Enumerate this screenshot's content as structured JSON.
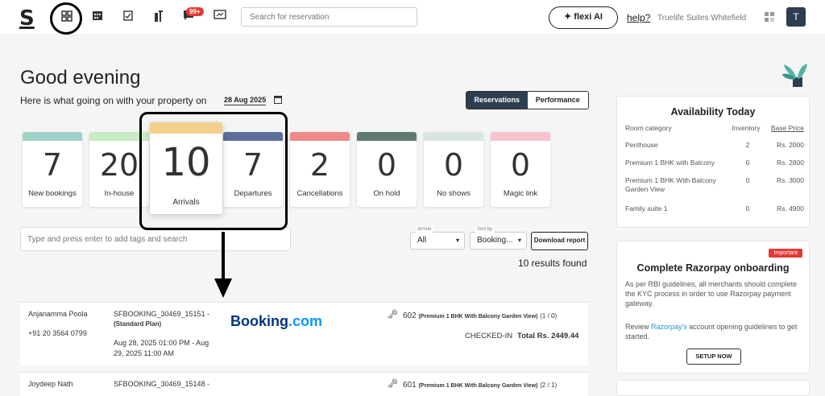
{
  "topbar": {
    "logo": "S",
    "badge": "99+",
    "search_placeholder": "Search for reservation",
    "flexi_label": "flexi AI",
    "help_label": "help?",
    "property_name": "Truelife Suites Whitefield",
    "avatar_initial": "T"
  },
  "header": {
    "greeting": "Good evening",
    "subline": "Here is what going on with your property on",
    "date": "28 Aug 2025",
    "tabs": [
      {
        "label": "Reservations",
        "active": true
      },
      {
        "label": "Performance",
        "active": false
      }
    ]
  },
  "stats": [
    {
      "value": "7",
      "label": "New bookings",
      "color": "#9fd3c7"
    },
    {
      "value": "20",
      "label": "In-house",
      "color": "#c8ecc4"
    },
    {
      "value": "10",
      "label": "Arrivals",
      "color": "#f5d08a"
    },
    {
      "value": "7",
      "label": "Departures",
      "color": "#5c6f9c"
    },
    {
      "value": "2",
      "label": "Cancellations",
      "color": "#f08a8a"
    },
    {
      "value": "0",
      "label": "On hold",
      "color": "#5f7a70"
    },
    {
      "value": "0",
      "label": "No shows",
      "color": "#d7e6e0"
    },
    {
      "value": "0",
      "label": "Magic link",
      "color": "#f7c3cc"
    }
  ],
  "filters": {
    "tag_placeholder": "Type and press enter to add tags and search",
    "arrival_label": "Arrival",
    "arrival_value": "All",
    "sort_label": "Sort by",
    "sort_value": "Booking...",
    "download_label": "Download report",
    "results": "10 results found"
  },
  "reservations": [
    {
      "guest": "Anjanamma Poola",
      "phone": "+91 20 3564 0799",
      "booking_id": "SFBOOKING_30469_15151 -",
      "plan": "(Standard Plan)",
      "dates": "Aug 28, 2025 01:00 PM - Aug 29, 2025 11:00 AM",
      "source_logo": "Booking",
      "source_logo_suffix": ".com",
      "room": "602",
      "room_type": "(Premium 1 BHK With Balcony Garden View)",
      "occupancy": "(1 / 0)",
      "status": "CHECKED-IN",
      "total_label": "Total",
      "total": "Rs. 2449.44"
    },
    {
      "guest": "Joydeep Nath",
      "booking_id": "SFBOOKING_30469_15148 -",
      "room": "601",
      "room_type": "(Premium 1 BHK With Balcony Garden View)",
      "occupancy": "(2 / 1)"
    }
  ],
  "availability": {
    "title": "Availability Today",
    "headers": [
      "Room category",
      "Inventory",
      "Base Price"
    ],
    "rows": [
      {
        "category": "Penthouse",
        "inventory": "2",
        "price": "Rs. 2000"
      },
      {
        "category": "Premium 1 BHK with Balcony",
        "inventory": "0",
        "price": "Rs. 2800"
      },
      {
        "category": "Premium 1 BHK With Balcony Garden View",
        "inventory": "0",
        "price": "Rs. 3000"
      },
      {
        "category": "Family suite 1",
        "inventory": "0",
        "price": "Rs. 4900"
      }
    ]
  },
  "razorpay": {
    "badge": "Important",
    "title": "Complete Razorpay onboarding",
    "text1": "As per RBI guidelines, all merchants should complete the KYC process in order to use Razorpay payment gateway.",
    "text2_pre": "Review ",
    "text2_link": "Razorpay's",
    "text2_post": " account opening guidelines to get started.",
    "button": "SETUP NOW"
  },
  "colors": {
    "dark": "#2c3e50",
    "accent_red": "#e53935",
    "link": "#1a9bd7"
  }
}
